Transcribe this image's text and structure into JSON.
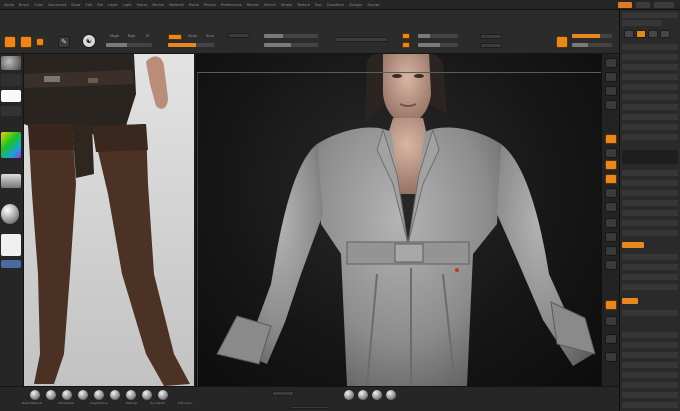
{
  "colors": {
    "accent": "#e8861f",
    "panel": "#2b2b2b",
    "background": "#1b1b1b"
  },
  "menu": {
    "items": [
      "Alpha",
      "Brush",
      "Color",
      "Document",
      "Draw",
      "Edit",
      "File",
      "Layer",
      "Light",
      "Macro",
      "Marker",
      "Material",
      "Movie",
      "Picture",
      "Preferences",
      "Render",
      "Stencil",
      "Stroke",
      "Texture",
      "Tool",
      "Transform",
      "Zplugin",
      "Zscript"
    ]
  },
  "shelf": {
    "icons": [
      "edit-icon",
      "draw-icon",
      "move-icon",
      "scale-icon",
      "rotate-icon",
      "lightbox-icon"
    ],
    "sliders": [
      {
        "name": "rgb-intensity-slider",
        "value": 0.45
      },
      {
        "name": "z-intensity-slider",
        "value": 0.6
      },
      {
        "name": "draw-size-slider",
        "value": 0.35
      },
      {
        "name": "focal-shift-slider",
        "value": 0.5
      }
    ],
    "toggles": [
      "Mrgb",
      "Rgb",
      "M",
      "Zadd",
      "Zsub",
      "Zcut"
    ]
  },
  "bottom": {
    "materials": [
      "BasicMaterial",
      "SkinShade",
      "ClayBuildup",
      "MatCap",
      "Toy Plastic",
      "Flat Color"
    ]
  }
}
